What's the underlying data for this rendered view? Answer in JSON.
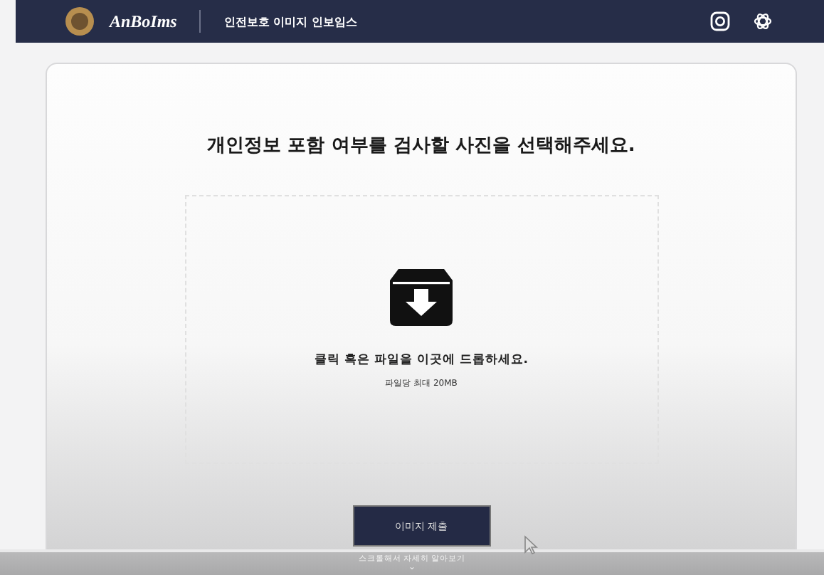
{
  "header": {
    "logo": "AnBoIms",
    "title": "인전보호 이미지 인보임스"
  },
  "upload": {
    "heading": "개인정보 포함 여부를 검사할 사진을 선택해주세요.",
    "drop_text": "클릭 혹은 파일을 이곳에 드롭하세요.",
    "limit": "파일당 최대 20MB"
  },
  "submit_button": "이미지 제출",
  "scroll_hint": {
    "text": "스크롤해서 자세히 알아보기",
    "arrow": "⌄"
  }
}
